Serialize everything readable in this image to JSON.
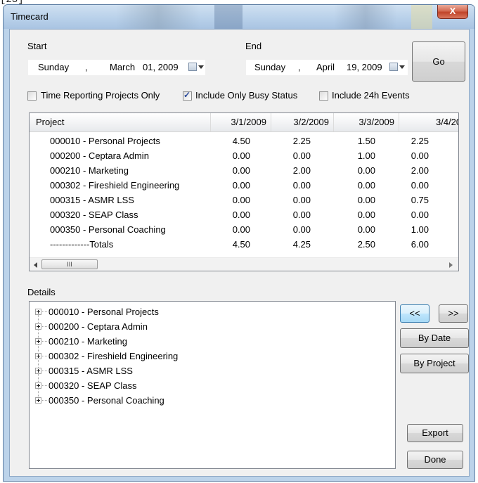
{
  "top_fragment": "[23]",
  "window": {
    "title": "Timecard",
    "close_label": "X"
  },
  "range": {
    "start_label": "Start",
    "end_label": "End",
    "start": {
      "day": "Sunday",
      "sep": ",",
      "month": "March",
      "date": "01, 2009"
    },
    "end": {
      "day": "Sunday",
      "sep": ",",
      "month": "April",
      "date": "19, 2009"
    },
    "go_label": "Go"
  },
  "options": [
    {
      "label": "Time Reporting Projects Only",
      "checked": false
    },
    {
      "label": "Include Only Busy Status",
      "checked": true
    },
    {
      "label": "Include 24h Events",
      "checked": false
    }
  ],
  "grid": {
    "columns": [
      "Project",
      "3/1/2009",
      "3/2/2009",
      "3/3/2009",
      "3/4/20"
    ],
    "rows": [
      {
        "project": "000010 - Personal Projects",
        "values": [
          "4.50",
          "2.25",
          "1.50",
          "2.25"
        ]
      },
      {
        "project": "000200 - Ceptara Admin",
        "values": [
          "0.00",
          "0.00",
          "1.00",
          "0.00"
        ]
      },
      {
        "project": "000210 - Marketing",
        "values": [
          "0.00",
          "2.00",
          "0.00",
          "2.00"
        ]
      },
      {
        "project": "000302 - Fireshield Engineering",
        "values": [
          "0.00",
          "0.00",
          "0.00",
          "0.00"
        ]
      },
      {
        "project": "000315 - ASMR LSS",
        "values": [
          "0.00",
          "0.00",
          "0.00",
          "0.75"
        ]
      },
      {
        "project": "000320 - SEAP Class",
        "values": [
          "0.00",
          "0.00",
          "0.00",
          "0.00"
        ]
      },
      {
        "project": "000350 - Personal Coaching",
        "values": [
          "0.00",
          "0.00",
          "0.00",
          "1.00"
        ]
      },
      {
        "project": "-------------Totals",
        "values": [
          "4.50",
          "4.25",
          "2.50",
          "6.00"
        ]
      }
    ],
    "scroll_thumb": "III"
  },
  "details": {
    "label": "Details",
    "items": [
      "000010 - Personal Projects",
      "000200 - Ceptara Admin",
      "000210 - Marketing",
      "000302 - Fireshield Engineering",
      "000315 - ASMR LSS",
      "000320 - SEAP Class",
      "000350 - Personal Coaching"
    ]
  },
  "buttons": {
    "prev": "<<",
    "next": ">>",
    "by_date": "By Date",
    "by_project": "By Project",
    "export": "Export",
    "done": "Done"
  },
  "colors": {
    "accent": "#3c7fb1",
    "window_frame": "#bcd3ea",
    "close_button": "#c0442a"
  }
}
